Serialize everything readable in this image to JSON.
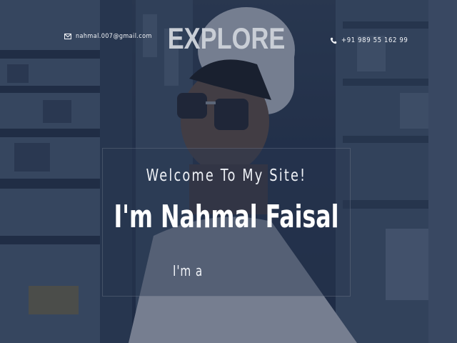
{
  "header": {
    "email": "nahmal.007@gmail.com",
    "email_icon": "envelope-icon",
    "brand": "EXPLORE",
    "phone": "+91 989 55 162 99",
    "phone_icon": "phone-icon"
  },
  "hero": {
    "welcome": "Welcome To My Site!",
    "name": "I'm Nahmal Faisal",
    "typed_prefix": "I'm a"
  },
  "colors": {
    "overlay": "#12203e",
    "text": "#ffffff",
    "brand": "#c9ced6"
  }
}
